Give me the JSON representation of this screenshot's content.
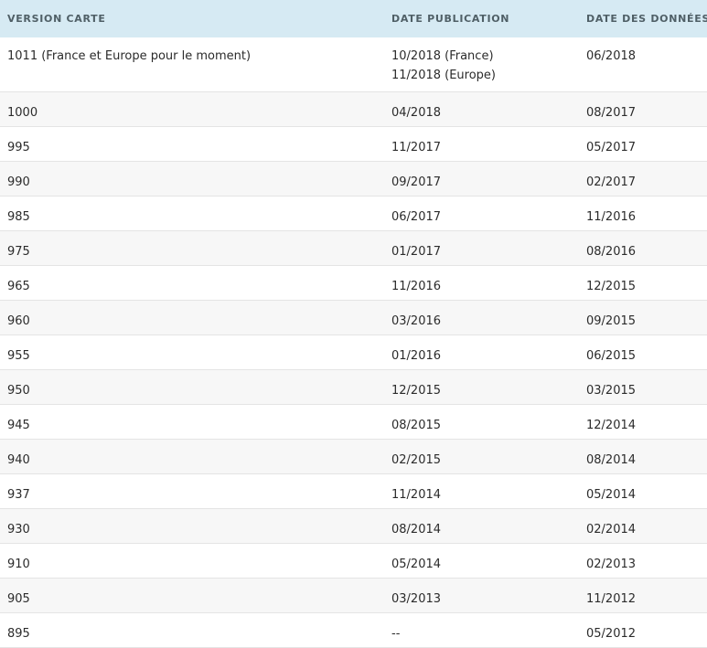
{
  "headers": {
    "version": "VERSION CARTE",
    "publication": "DATE PUBLICATION",
    "data": "DATE DES DONNÉES"
  },
  "rows": [
    {
      "version": "1011 (France et Europe pour le moment)",
      "publication": [
        "10/2018 (France)",
        "11/2018 (Europe)"
      ],
      "data": "06/2018"
    },
    {
      "version": "1000",
      "publication": [
        "04/2018"
      ],
      "data": "08/2017"
    },
    {
      "version": "995",
      "publication": [
        "11/2017"
      ],
      "data": "05/2017"
    },
    {
      "version": "990",
      "publication": [
        "09/2017"
      ],
      "data": "02/2017"
    },
    {
      "version": "985",
      "publication": [
        "06/2017"
      ],
      "data": "11/2016"
    },
    {
      "version": "975",
      "publication": [
        "01/2017"
      ],
      "data": "08/2016"
    },
    {
      "version": "965",
      "publication": [
        "11/2016"
      ],
      "data": "12/2015"
    },
    {
      "version": "960",
      "publication": [
        "03/2016"
      ],
      "data": "09/2015"
    },
    {
      "version": "955",
      "publication": [
        "01/2016"
      ],
      "data": "06/2015"
    },
    {
      "version": "950",
      "publication": [
        "12/2015"
      ],
      "data": "03/2015"
    },
    {
      "version": "945",
      "publication": [
        "08/2015"
      ],
      "data": "12/2014"
    },
    {
      "version": "940",
      "publication": [
        "02/2015"
      ],
      "data": "08/2014"
    },
    {
      "version": "937",
      "publication": [
        "11/2014"
      ],
      "data": "05/2014"
    },
    {
      "version": "930",
      "publication": [
        "08/2014"
      ],
      "data": "02/2014"
    },
    {
      "version": "910",
      "publication": [
        "05/2014"
      ],
      "data": "02/2013"
    },
    {
      "version": "905",
      "publication": [
        "03/2013"
      ],
      "data": "11/2012"
    },
    {
      "version": "895",
      "publication": [
        "--"
      ],
      "data": "05/2012"
    }
  ],
  "colors": {
    "header_background": "#d6eaf3",
    "header_text": "#4f5f66",
    "alt_row_background": "#f7f7f7",
    "row_border": "#e4e4e4",
    "text": "#2b2b2b"
  }
}
